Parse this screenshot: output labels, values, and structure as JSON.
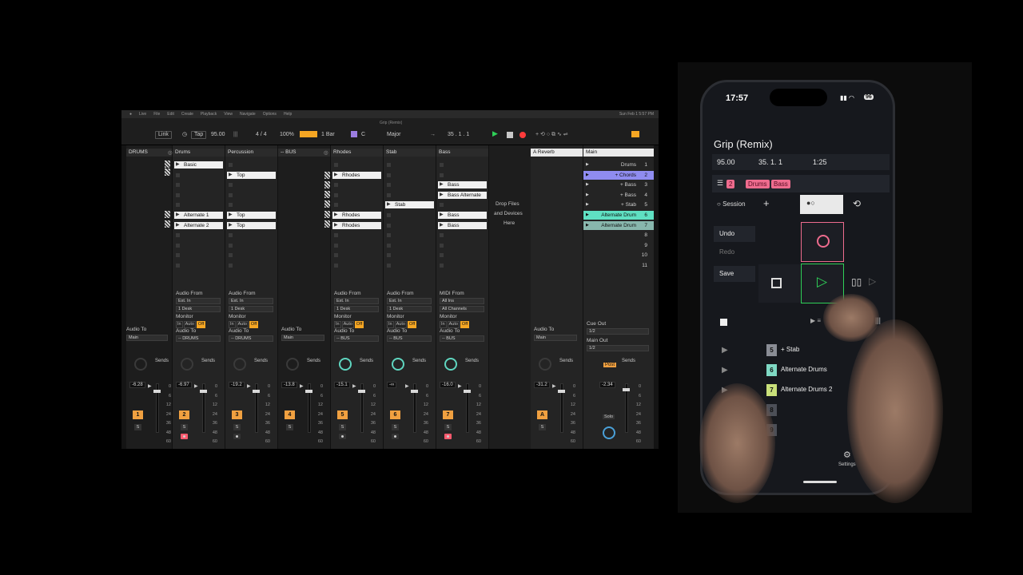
{
  "menubar": {
    "items": [
      "Live",
      "File",
      "Edit",
      "Create",
      "Playback",
      "View",
      "Navigate",
      "Options",
      "Help"
    ],
    "title": "Grip (Remix)",
    "clock": "Sun Feb 1 5:57 PM"
  },
  "toolbar": {
    "link": "Link",
    "tap": "Tap",
    "tempo": "95.00",
    "signature": "4 / 4",
    "zoom": "100%",
    "quant": "1 Bar",
    "key": "C",
    "scale": "Major",
    "position": "35 .  1 .  1"
  },
  "tracks": [
    {
      "name": "DRUMS",
      "number": "1",
      "volume": "-6.28",
      "audio_to": "Audio To",
      "route": "Main",
      "slots": [
        {
          "hatch": true
        },
        {
          "hatch": true
        }
      ]
    },
    {
      "name": "Drums",
      "number": "2",
      "volume": "-6.97",
      "clips": {
        "0": "Basic",
        "5": "Alternate 1",
        "6": "Alternate 2"
      },
      "input_label": "Audio From",
      "input": "Ext. In",
      "channel": "1 Desk",
      "route": "-- DRUMS"
    },
    {
      "name": "Percussion",
      "number": "3",
      "volume": "-19.2",
      "clips": {
        "1": "Top",
        "5": "Top",
        "6": "Top"
      },
      "input_label": "Audio From",
      "input": "Ext. In",
      "channel": "1 Desk",
      "route": "-- DRUMS"
    },
    {
      "name": "-- BUS",
      "number": "4",
      "volume": "-13.8",
      "audio_to": "Audio To",
      "route": "Main"
    },
    {
      "name": "Rhodes",
      "number": "5",
      "volume": "-15.1",
      "clips": {
        "1": "Rhodes",
        "5": "Rhodes",
        "6": "Rhodes"
      },
      "input_label": "Audio From",
      "input": "Ext. In",
      "channel": "1 Desk",
      "route": "-- BUS"
    },
    {
      "name": "Stab",
      "number": "6",
      "volume": "-∞",
      "clips": {
        "4": "Stab"
      },
      "input_label": "Audio From",
      "input": "Ext. In",
      "channel": "1 Desk",
      "route": "-- BUS"
    },
    {
      "name": "Bass",
      "number": "7",
      "volume": "-16.0",
      "clips": {
        "2": "Bass",
        "3": "Bass Alternate",
        "5": "Bass",
        "6": "Bass"
      },
      "input_label": "MIDI From",
      "input": "All Ins",
      "channel": "All Channels",
      "route": "-- BUS"
    }
  ],
  "monitor": {
    "label": "Monitor",
    "in": "In",
    "auto": "Auto",
    "off": "Off"
  },
  "audio_to_label": "Audio To",
  "sends_label": "Sends",
  "drop_text": [
    "Drop Files",
    "and Devices",
    "Here"
  ],
  "return_track": {
    "name": "A Reverb",
    "number": "A",
    "volume": "-31.2",
    "audio_to": "Audio To",
    "route": "Main"
  },
  "main_track": {
    "name": "Main",
    "cue_label": "Cue Out",
    "cue": "1/2",
    "main_out_label": "Main Out",
    "main_out": "1/2",
    "post": "Post",
    "volume": "-2.34",
    "solo": "Solo",
    "scenes": [
      {
        "name": "Drums",
        "n": "1"
      },
      {
        "name": "+ Chords",
        "n": "2"
      },
      {
        "name": "+ Bass",
        "n": "3"
      },
      {
        "name": "+ Bass",
        "n": "4"
      },
      {
        "name": "+ Stab",
        "n": "5"
      },
      {
        "name": "Alternate Drum",
        "n": "6"
      },
      {
        "name": "Alternate Drum",
        "n": "7"
      },
      {
        "name": "",
        "n": "8"
      },
      {
        "name": "",
        "n": "9"
      },
      {
        "name": "",
        "n": "10"
      },
      {
        "name": "",
        "n": "11"
      }
    ]
  },
  "scale_ticks": [
    "0",
    "6",
    "12",
    "24",
    "36",
    "48",
    "60"
  ],
  "phone": {
    "time": "17:57",
    "battery": "96",
    "title": "Grip (Remix)",
    "tempo": "95.00",
    "position": "35.  1.  1",
    "time_elapsed": "1:25",
    "tags": {
      "count": "2",
      "a": "Drums",
      "b": "Bass"
    },
    "session": "Session",
    "plus": "+",
    "undo": "Undo",
    "redo": "Redo",
    "save": "Save",
    "scenes": [
      {
        "n": "5",
        "name": "+ Stab",
        "color": "#8a8d95"
      },
      {
        "n": "6",
        "name": "Alternate Drums",
        "color": "#7fd9c4"
      },
      {
        "n": "7",
        "name": "Alternate Drums 2",
        "color": "#c9e07a"
      },
      {
        "n": "8",
        "name": "",
        "color": "#4c4f57"
      },
      {
        "n": "9",
        "name": "",
        "color": "#4c4f57"
      }
    ],
    "settings": "Settings"
  },
  "colors": {
    "accent": "#f5a623",
    "play": "#2fd158",
    "record": "#ff3b3b",
    "pink": "#ee6c8e",
    "scene_purple": "#8f8cf0",
    "scene_teal": "#5fe0c2"
  }
}
